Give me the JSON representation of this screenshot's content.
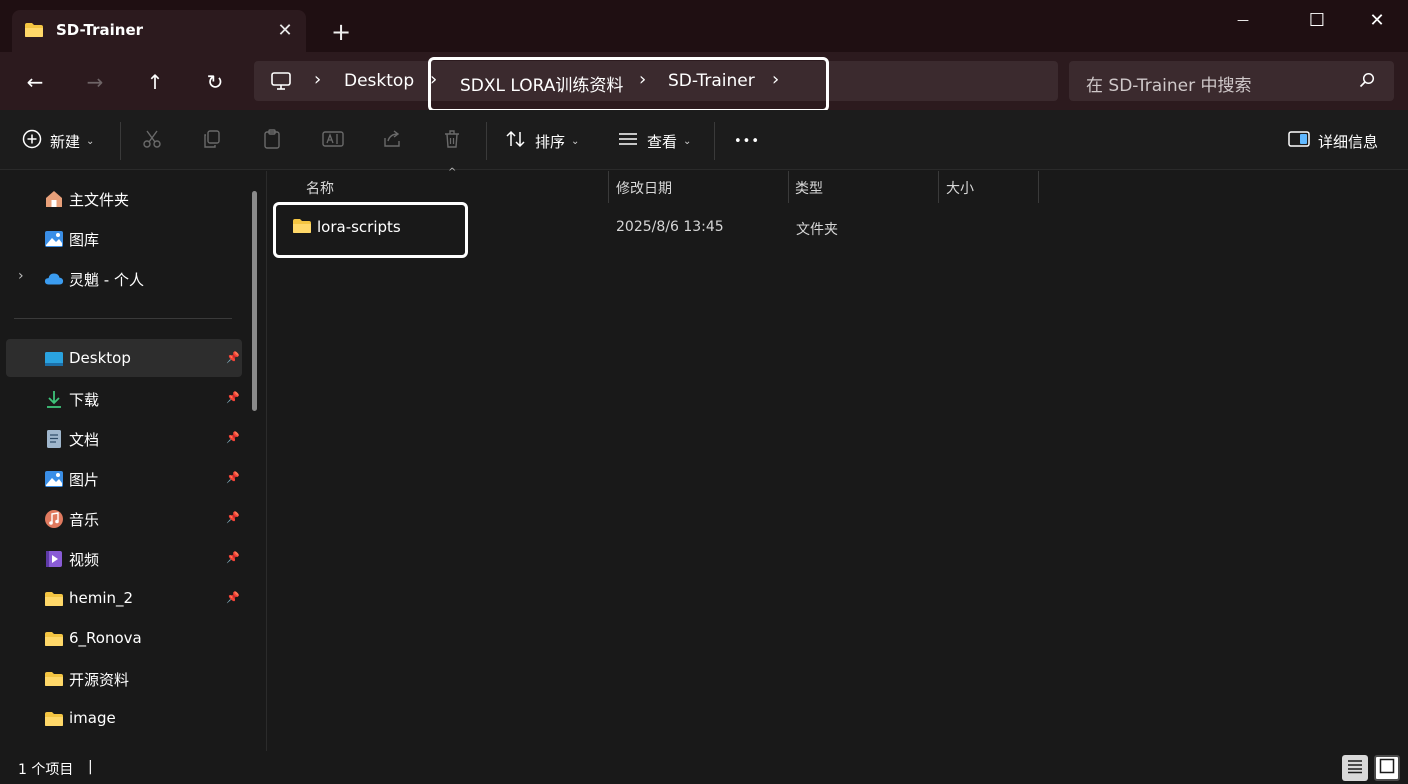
{
  "window": {
    "tab_title": "SD-Trainer",
    "tab_close_glyph": "✕",
    "new_tab_glyph": "+",
    "minimize_glyph": "—",
    "maximize_glyph": "☐",
    "close_glyph": "✕"
  },
  "address": {
    "back_glyph": "←",
    "forward_glyph": "→",
    "up_glyph": "↑",
    "refresh_glyph": "↻",
    "crumbs": [
      "Desktop",
      "SDXL LORA训练资料",
      "SD-Trainer"
    ],
    "separator": "›",
    "search_placeholder": "在 SD-Trainer 中搜索"
  },
  "commands": {
    "new_label": "新建",
    "sort_label": "排序",
    "view_label": "查看",
    "more_glyph": "•••",
    "details_label": "详细信息",
    "chevron": "⌄"
  },
  "sidebar": {
    "top_items": [
      {
        "label": "主文件夹",
        "icon": "home-icon"
      },
      {
        "label": "图库",
        "icon": "gallery-icon"
      },
      {
        "label": "灵魈 - 个人",
        "icon": "cloud-icon",
        "expandable": true
      }
    ],
    "expand_glyph": "›",
    "pin_glyph": "📌",
    "quick_items": [
      {
        "label": "Desktop",
        "icon": "desktop-icon",
        "pinned": true,
        "selected": true
      },
      {
        "label": "下载",
        "icon": "download-icon",
        "pinned": true
      },
      {
        "label": "文档",
        "icon": "document-icon",
        "pinned": true
      },
      {
        "label": "图片",
        "icon": "pictures-icon",
        "pinned": true
      },
      {
        "label": "音乐",
        "icon": "music-icon",
        "pinned": true
      },
      {
        "label": "视频",
        "icon": "video-icon",
        "pinned": true
      },
      {
        "label": "hemin_2",
        "icon": "folder-icon",
        "pinned": true
      },
      {
        "label": "6_Ronova",
        "icon": "folder-icon",
        "pinned": false
      },
      {
        "label": "开源资料",
        "icon": "folder-icon",
        "pinned": false
      },
      {
        "label": "image",
        "icon": "folder-icon",
        "pinned": false
      }
    ]
  },
  "file_list": {
    "columns": [
      "名称",
      "修改日期",
      "类型",
      "大小"
    ],
    "sort_glyph": "^",
    "rows": [
      {
        "name": "lora-scripts",
        "modified": "2025/8/6 13:45",
        "type": "文件夹",
        "size": "",
        "icon": "folder-icon"
      }
    ]
  },
  "status": {
    "item_count": "1 个项目",
    "separator": "|"
  },
  "colors": {
    "title_bg": "#1f0f12",
    "address_bg": "#2c1a1e",
    "field_bg": "#3b2a2e",
    "body_bg": "#191919",
    "folder_yellow": "#f4c542",
    "highlight": "#ffffff"
  }
}
